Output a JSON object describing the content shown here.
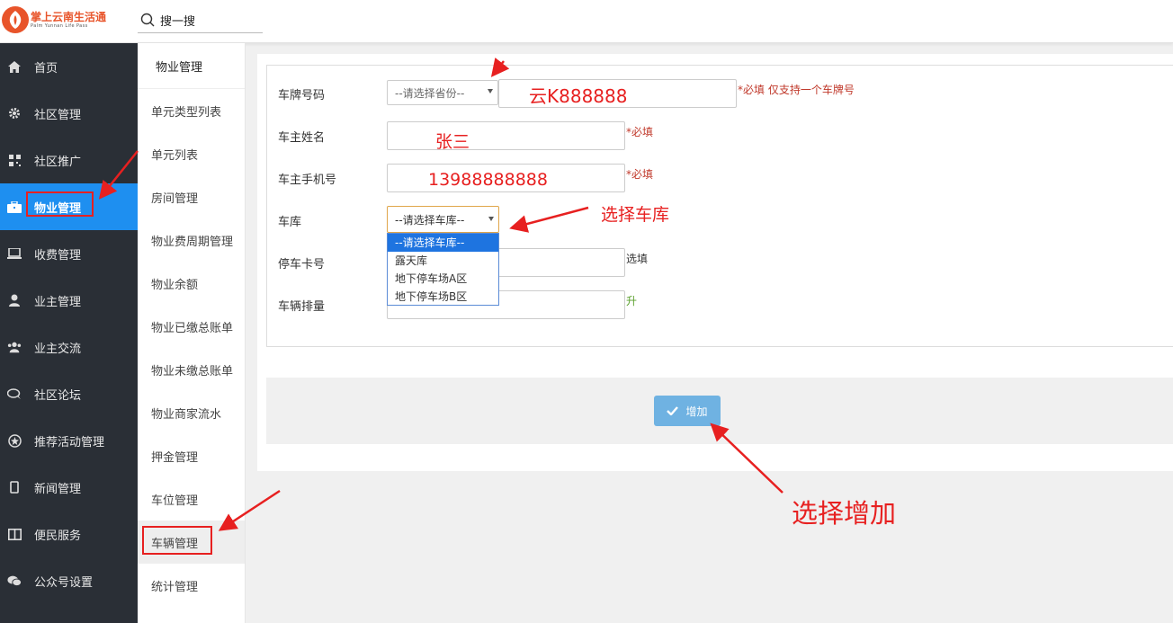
{
  "header": {
    "logo_cn": "掌上云南生活通",
    "logo_en": "Palm Yunnan Life Pass",
    "search_placeholder": "搜一搜"
  },
  "sidebar": {
    "items": [
      {
        "label": "首页",
        "icon": "home-icon"
      },
      {
        "label": "社区管理",
        "icon": "gear-icon"
      },
      {
        "label": "社区推广",
        "icon": "qrcode-icon"
      },
      {
        "label": "物业管理",
        "icon": "briefcase-icon",
        "active": true
      },
      {
        "label": "收费管理",
        "icon": "laptop-icon"
      },
      {
        "label": "业主管理",
        "icon": "user-icon"
      },
      {
        "label": "业主交流",
        "icon": "users-icon"
      },
      {
        "label": "社区论坛",
        "icon": "chat-icon"
      },
      {
        "label": "推荐活动管理",
        "icon": "star-circle-icon"
      },
      {
        "label": "新闻管理",
        "icon": "mobile-icon"
      },
      {
        "label": "便民服务",
        "icon": "columns-icon"
      },
      {
        "label": "公众号设置",
        "icon": "wechat-icon"
      }
    ]
  },
  "subnav": {
    "title": "物业管理",
    "items": [
      {
        "label": "单元类型列表"
      },
      {
        "label": "单元列表"
      },
      {
        "label": "房间管理"
      },
      {
        "label": "物业费周期管理"
      },
      {
        "label": "物业余额"
      },
      {
        "label": "物业已缴总账单"
      },
      {
        "label": "物业未缴总账单"
      },
      {
        "label": "物业商家流水"
      },
      {
        "label": "押金管理"
      },
      {
        "label": "车位管理"
      },
      {
        "label": "车辆管理",
        "active": true
      },
      {
        "label": "统计管理"
      }
    ]
  },
  "form": {
    "plate_label": "车牌号码",
    "province_select": "--请选择省份--",
    "plate_value": "云K888888",
    "plate_hint": "*必填 仅支持一个车牌号",
    "owner_label": "车主姓名",
    "owner_value": "张三",
    "owner_hint": "*必填",
    "phone_label": "车主手机号",
    "phone_value": "13988888888",
    "phone_hint": "*必填",
    "garage_label": "车库",
    "garage_select": "--请选择车库--",
    "garage_options": [
      "--请选择车库--",
      "露天库",
      "地下停车场A区",
      "地下停车场B区"
    ],
    "card_label": "停车卡号",
    "card_hint": "选填",
    "displacement_label": "车辆排量",
    "displacement_hint": "升",
    "add_button": "增加"
  },
  "annotations": {
    "select_garage": "选择车库",
    "select_add": "选择增加"
  },
  "colors": {
    "sidebar_bg": "#2a2f36",
    "active_blue": "#1e8ff0",
    "annotation_red": "#e72020",
    "button_blue": "#6fb2e2"
  }
}
